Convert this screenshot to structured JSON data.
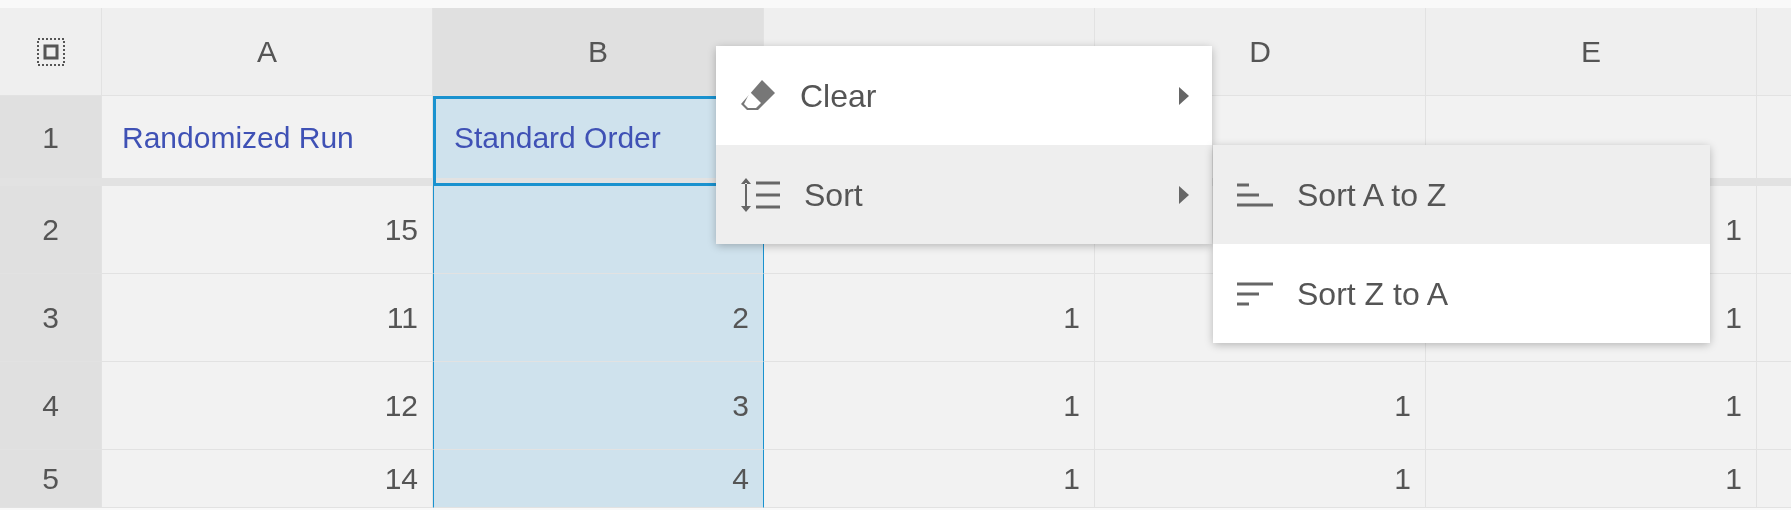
{
  "columns": [
    {
      "letter": "A",
      "selected": false
    },
    {
      "letter": "B",
      "selected": true
    },
    {
      "selected": false
    },
    {
      "letter": "D",
      "selected": false
    },
    {
      "letter": "E",
      "selected": false
    },
    {
      "selected": false
    }
  ],
  "header_row": {
    "number": "1",
    "cells": [
      {
        "text": "Randomized Run",
        "active": false
      },
      {
        "text": "Standard Order",
        "active": true
      },
      {},
      {
        "active": false
      },
      {
        "active": false
      },
      {
        "active": false
      }
    ]
  },
  "rows": [
    {
      "number": "2",
      "cells": [
        "15",
        null,
        null,
        null,
        "1",
        null
      ]
    },
    {
      "number": "3",
      "cells": [
        "11",
        "2",
        "1",
        null,
        "1",
        null
      ]
    },
    {
      "number": "4",
      "cells": [
        "12",
        "3",
        "1",
        "1",
        "1",
        null
      ]
    },
    {
      "number": "5",
      "cells": [
        "14",
        "4",
        "1",
        "1",
        "1",
        null
      ]
    }
  ],
  "context_menu": [
    {
      "kind": "clear",
      "label": "Clear",
      "selected": false
    },
    {
      "kind": "sort",
      "label": "Sort",
      "selected": true
    }
  ],
  "submenu": [
    {
      "kind": "asc",
      "label": "Sort A to Z",
      "selected": true
    },
    {
      "kind": "desc",
      "label": "Sort Z to A",
      "selected": false
    }
  ]
}
